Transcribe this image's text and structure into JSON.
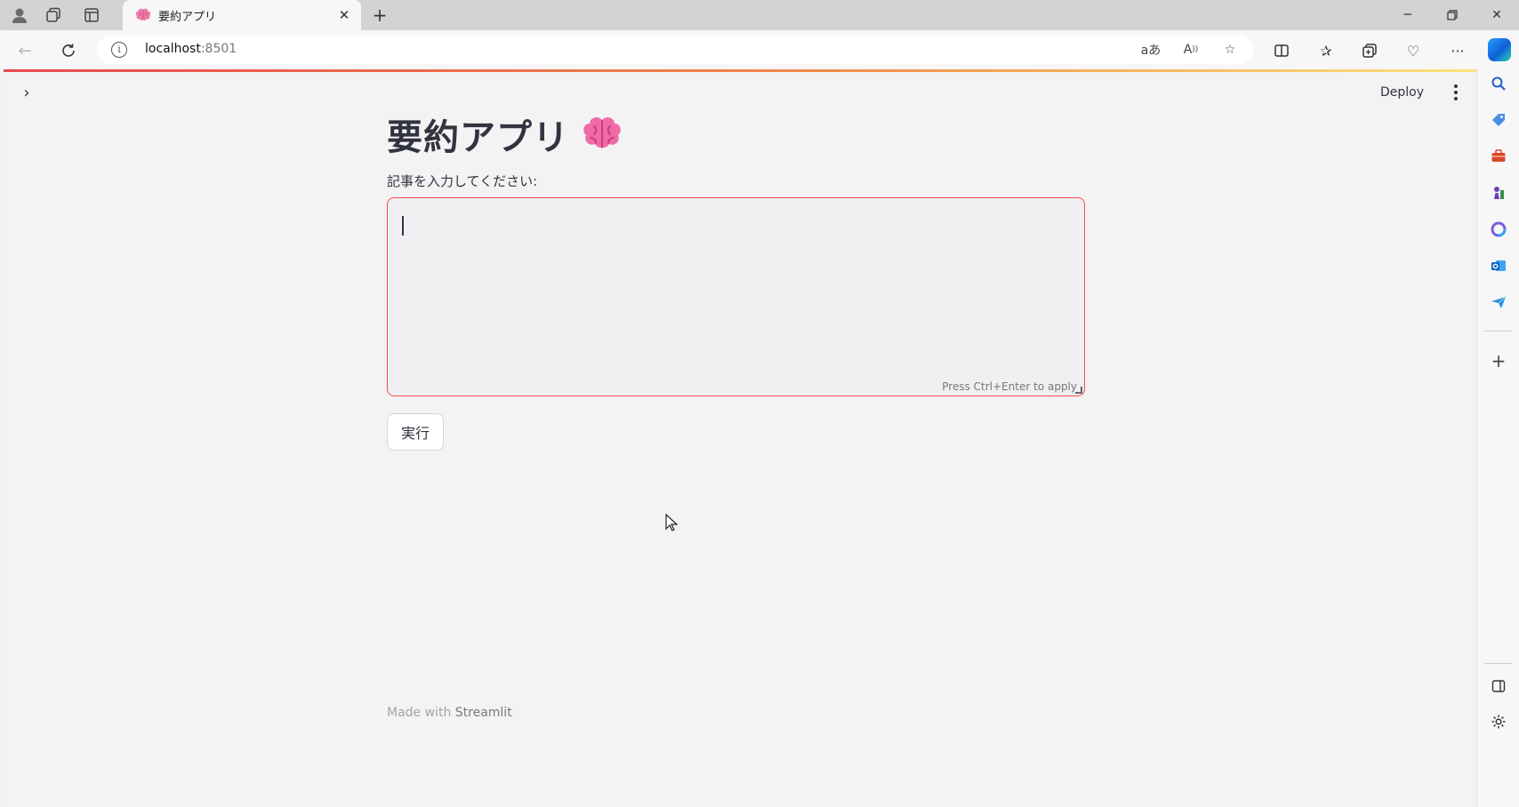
{
  "browser": {
    "tab": {
      "title": "要約アプリ",
      "close_icon": "close-icon"
    },
    "address": {
      "host": "localhost",
      "port": ":8501"
    },
    "window_controls": [
      "minimize",
      "restore",
      "close"
    ]
  },
  "app": {
    "header": {
      "deploy_label": "Deploy"
    },
    "title": "要約アプリ",
    "title_emoji": "brain-emoji",
    "input": {
      "label": "記事を入力してください:",
      "value": "",
      "hint": "Press Ctrl+Enter to apply"
    },
    "run_button_label": "実行",
    "footer": {
      "prefix": "Made with ",
      "link": "Streamlit"
    }
  },
  "colors": {
    "accent": "#ff4b4b",
    "accent_gradient": [
      "#e8484f",
      "#f08a4b",
      "#fce37a"
    ],
    "text": "#31333f",
    "background": "#f3f3f3"
  }
}
